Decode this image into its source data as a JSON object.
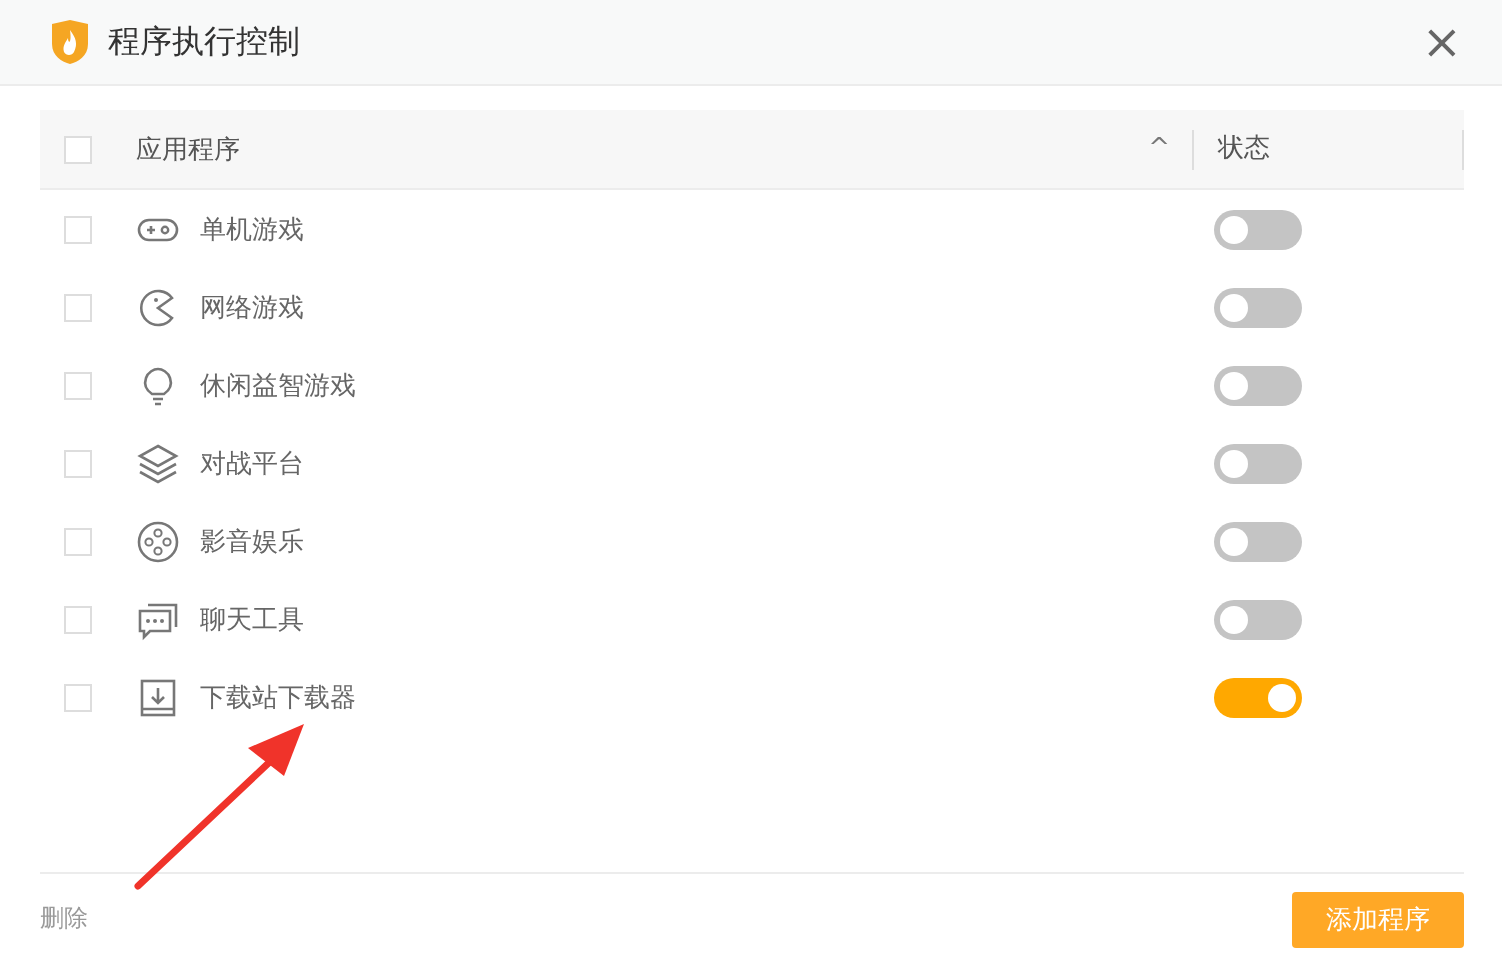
{
  "window": {
    "title": "程序执行控制",
    "close": "×"
  },
  "table": {
    "select_all": {
      "checked": false
    },
    "columns": [
      "应用程序",
      "状态"
    ],
    "sort_indicator": "^",
    "rows": [
      {
        "name": "单机游戏",
        "checked": false,
        "on": false
      },
      {
        "name": "网络游戏",
        "checked": false,
        "on": false
      },
      {
        "name": "休闲益智游戏",
        "checked": false,
        "on": false
      },
      {
        "name": "对战平台",
        "checked": false,
        "on": false
      },
      {
        "name": "影音娱乐",
        "checked": false,
        "on": false
      },
      {
        "name": "聊天工具",
        "checked": false,
        "on": false
      },
      {
        "name": "下载站下载器",
        "checked": false,
        "on": true
      }
    ]
  },
  "footer": {
    "delete": "删除",
    "add": "添加程序"
  }
}
